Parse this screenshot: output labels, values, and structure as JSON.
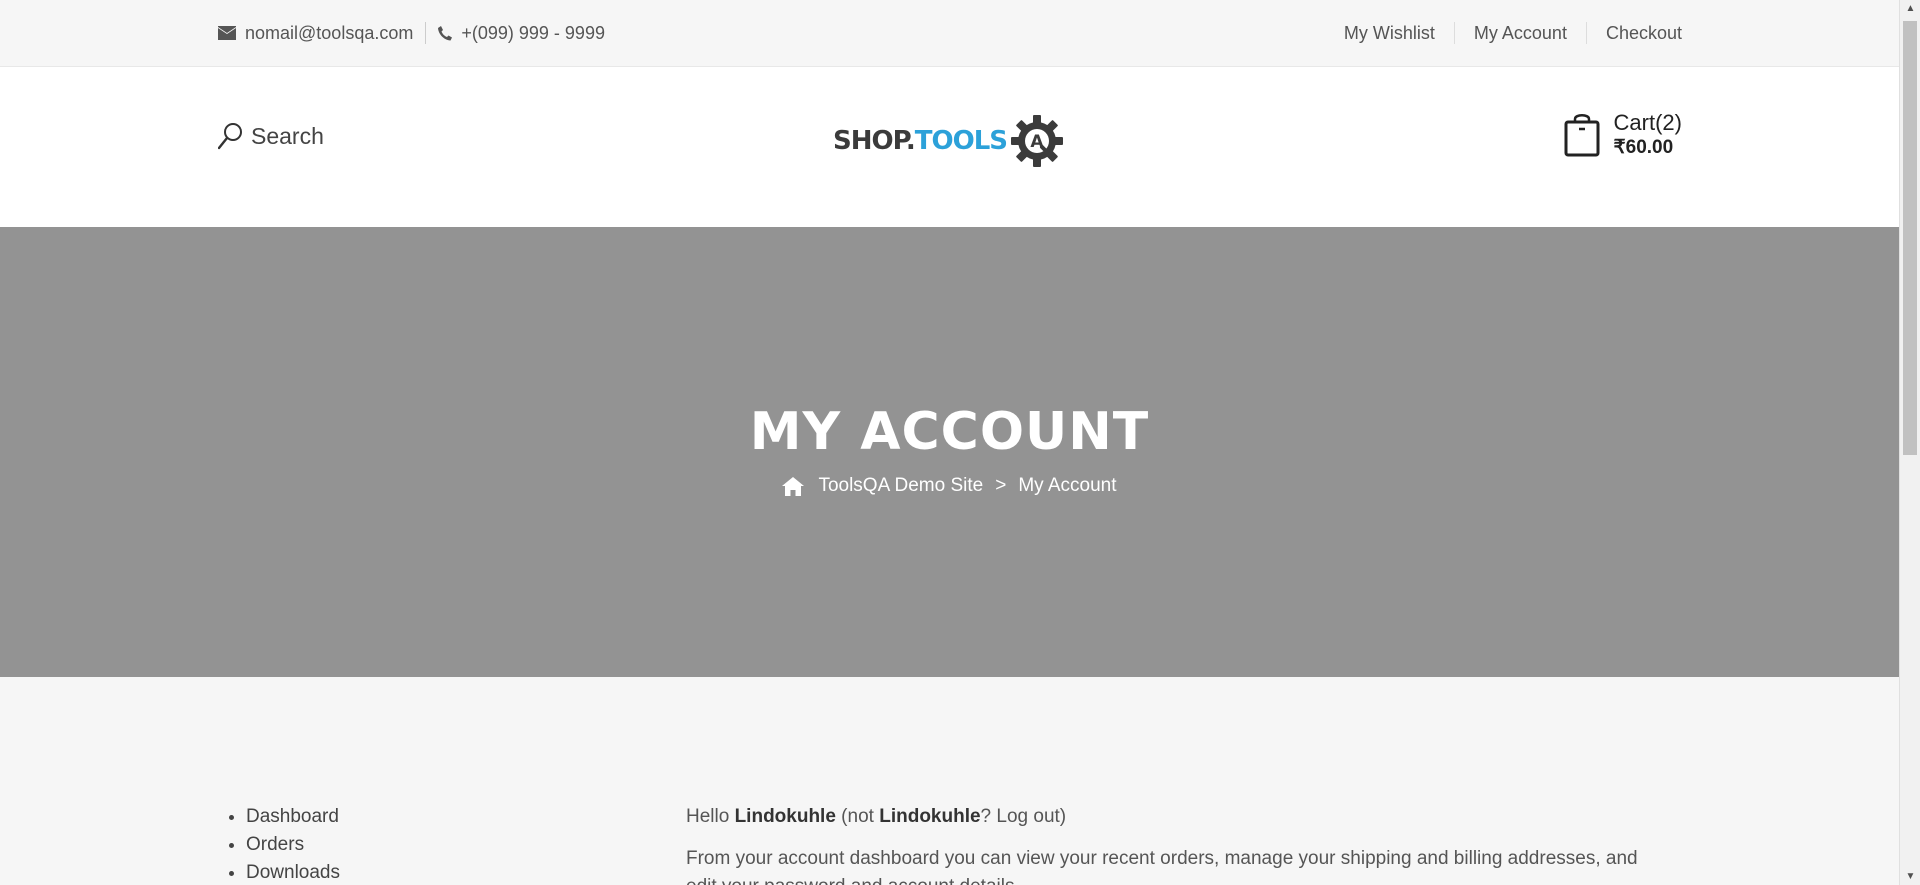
{
  "topbar": {
    "email": "nomail@toolsqa.com",
    "phone": "+(099) 999 - 9999",
    "links": [
      "My Wishlist",
      "My Account",
      "Checkout"
    ]
  },
  "header": {
    "search_label": "Search",
    "logo_part1": "SHOP.",
    "logo_part2": "TOOLS",
    "logo_letter": "A",
    "cart_label": "Cart(2)",
    "cart_amount": "₹60.00"
  },
  "banner": {
    "title": "MY ACCOUNT",
    "breadcrumb_home": "ToolsQA Demo Site",
    "breadcrumb_sep": ">",
    "breadcrumb_current": "My Account"
  },
  "account_nav": [
    "Dashboard",
    "Orders",
    "Downloads"
  ],
  "dashboard": {
    "hello": "Hello ",
    "user": "Lindokuhle",
    "not": " (not ",
    "user2": "Lindokuhle",
    "logout": "? Log out)",
    "description": "From your account dashboard you can view your recent orders, manage your shipping and billing addresses, and edit your password and account details."
  },
  "colors": {
    "banner_bg": "#939393",
    "logo_accent": "#2ca1d9"
  }
}
